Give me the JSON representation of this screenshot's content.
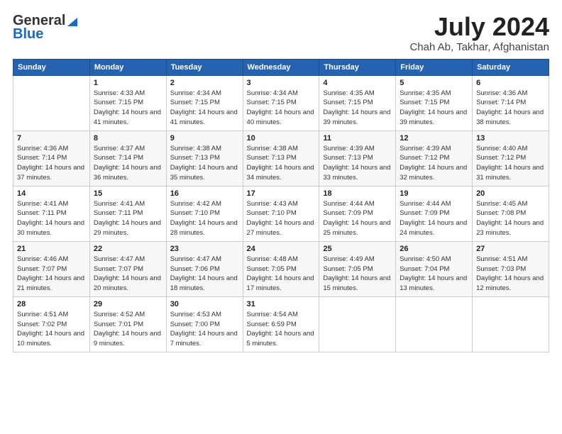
{
  "header": {
    "logo_general": "General",
    "logo_blue": "Blue",
    "main_title": "July 2024",
    "subtitle": "Chah Ab, Takhar, Afghanistan"
  },
  "calendar": {
    "headers": [
      "Sunday",
      "Monday",
      "Tuesday",
      "Wednesday",
      "Thursday",
      "Friday",
      "Saturday"
    ],
    "rows": [
      [
        {
          "day": "",
          "sunrise": "",
          "sunset": "",
          "daylight": ""
        },
        {
          "day": "1",
          "sunrise": "Sunrise: 4:33 AM",
          "sunset": "Sunset: 7:15 PM",
          "daylight": "Daylight: 14 hours and 41 minutes."
        },
        {
          "day": "2",
          "sunrise": "Sunrise: 4:34 AM",
          "sunset": "Sunset: 7:15 PM",
          "daylight": "Daylight: 14 hours and 41 minutes."
        },
        {
          "day": "3",
          "sunrise": "Sunrise: 4:34 AM",
          "sunset": "Sunset: 7:15 PM",
          "daylight": "Daylight: 14 hours and 40 minutes."
        },
        {
          "day": "4",
          "sunrise": "Sunrise: 4:35 AM",
          "sunset": "Sunset: 7:15 PM",
          "daylight": "Daylight: 14 hours and 39 minutes."
        },
        {
          "day": "5",
          "sunrise": "Sunrise: 4:35 AM",
          "sunset": "Sunset: 7:15 PM",
          "daylight": "Daylight: 14 hours and 39 minutes."
        },
        {
          "day": "6",
          "sunrise": "Sunrise: 4:36 AM",
          "sunset": "Sunset: 7:14 PM",
          "daylight": "Daylight: 14 hours and 38 minutes."
        }
      ],
      [
        {
          "day": "7",
          "sunrise": "Sunrise: 4:36 AM",
          "sunset": "Sunset: 7:14 PM",
          "daylight": "Daylight: 14 hours and 37 minutes."
        },
        {
          "day": "8",
          "sunrise": "Sunrise: 4:37 AM",
          "sunset": "Sunset: 7:14 PM",
          "daylight": "Daylight: 14 hours and 36 minutes."
        },
        {
          "day": "9",
          "sunrise": "Sunrise: 4:38 AM",
          "sunset": "Sunset: 7:13 PM",
          "daylight": "Daylight: 14 hours and 35 minutes."
        },
        {
          "day": "10",
          "sunrise": "Sunrise: 4:38 AM",
          "sunset": "Sunset: 7:13 PM",
          "daylight": "Daylight: 14 hours and 34 minutes."
        },
        {
          "day": "11",
          "sunrise": "Sunrise: 4:39 AM",
          "sunset": "Sunset: 7:13 PM",
          "daylight": "Daylight: 14 hours and 33 minutes."
        },
        {
          "day": "12",
          "sunrise": "Sunrise: 4:39 AM",
          "sunset": "Sunset: 7:12 PM",
          "daylight": "Daylight: 14 hours and 32 minutes."
        },
        {
          "day": "13",
          "sunrise": "Sunrise: 4:40 AM",
          "sunset": "Sunset: 7:12 PM",
          "daylight": "Daylight: 14 hours and 31 minutes."
        }
      ],
      [
        {
          "day": "14",
          "sunrise": "Sunrise: 4:41 AM",
          "sunset": "Sunset: 7:11 PM",
          "daylight": "Daylight: 14 hours and 30 minutes."
        },
        {
          "day": "15",
          "sunrise": "Sunrise: 4:41 AM",
          "sunset": "Sunset: 7:11 PM",
          "daylight": "Daylight: 14 hours and 29 minutes."
        },
        {
          "day": "16",
          "sunrise": "Sunrise: 4:42 AM",
          "sunset": "Sunset: 7:10 PM",
          "daylight": "Daylight: 14 hours and 28 minutes."
        },
        {
          "day": "17",
          "sunrise": "Sunrise: 4:43 AM",
          "sunset": "Sunset: 7:10 PM",
          "daylight": "Daylight: 14 hours and 27 minutes."
        },
        {
          "day": "18",
          "sunrise": "Sunrise: 4:44 AM",
          "sunset": "Sunset: 7:09 PM",
          "daylight": "Daylight: 14 hours and 25 minutes."
        },
        {
          "day": "19",
          "sunrise": "Sunrise: 4:44 AM",
          "sunset": "Sunset: 7:09 PM",
          "daylight": "Daylight: 14 hours and 24 minutes."
        },
        {
          "day": "20",
          "sunrise": "Sunrise: 4:45 AM",
          "sunset": "Sunset: 7:08 PM",
          "daylight": "Daylight: 14 hours and 23 minutes."
        }
      ],
      [
        {
          "day": "21",
          "sunrise": "Sunrise: 4:46 AM",
          "sunset": "Sunset: 7:07 PM",
          "daylight": "Daylight: 14 hours and 21 minutes."
        },
        {
          "day": "22",
          "sunrise": "Sunrise: 4:47 AM",
          "sunset": "Sunset: 7:07 PM",
          "daylight": "Daylight: 14 hours and 20 minutes."
        },
        {
          "day": "23",
          "sunrise": "Sunrise: 4:47 AM",
          "sunset": "Sunset: 7:06 PM",
          "daylight": "Daylight: 14 hours and 18 minutes."
        },
        {
          "day": "24",
          "sunrise": "Sunrise: 4:48 AM",
          "sunset": "Sunset: 7:05 PM",
          "daylight": "Daylight: 14 hours and 17 minutes."
        },
        {
          "day": "25",
          "sunrise": "Sunrise: 4:49 AM",
          "sunset": "Sunset: 7:05 PM",
          "daylight": "Daylight: 14 hours and 15 minutes."
        },
        {
          "day": "26",
          "sunrise": "Sunrise: 4:50 AM",
          "sunset": "Sunset: 7:04 PM",
          "daylight": "Daylight: 14 hours and 13 minutes."
        },
        {
          "day": "27",
          "sunrise": "Sunrise: 4:51 AM",
          "sunset": "Sunset: 7:03 PM",
          "daylight": "Daylight: 14 hours and 12 minutes."
        }
      ],
      [
        {
          "day": "28",
          "sunrise": "Sunrise: 4:51 AM",
          "sunset": "Sunset: 7:02 PM",
          "daylight": "Daylight: 14 hours and 10 minutes."
        },
        {
          "day": "29",
          "sunrise": "Sunrise: 4:52 AM",
          "sunset": "Sunset: 7:01 PM",
          "daylight": "Daylight: 14 hours and 9 minutes."
        },
        {
          "day": "30",
          "sunrise": "Sunrise: 4:53 AM",
          "sunset": "Sunset: 7:00 PM",
          "daylight": "Daylight: 14 hours and 7 minutes."
        },
        {
          "day": "31",
          "sunrise": "Sunrise: 4:54 AM",
          "sunset": "Sunset: 6:59 PM",
          "daylight": "Daylight: 14 hours and 5 minutes."
        },
        {
          "day": "",
          "sunrise": "",
          "sunset": "",
          "daylight": ""
        },
        {
          "day": "",
          "sunrise": "",
          "sunset": "",
          "daylight": ""
        },
        {
          "day": "",
          "sunrise": "",
          "sunset": "",
          "daylight": ""
        }
      ]
    ]
  }
}
